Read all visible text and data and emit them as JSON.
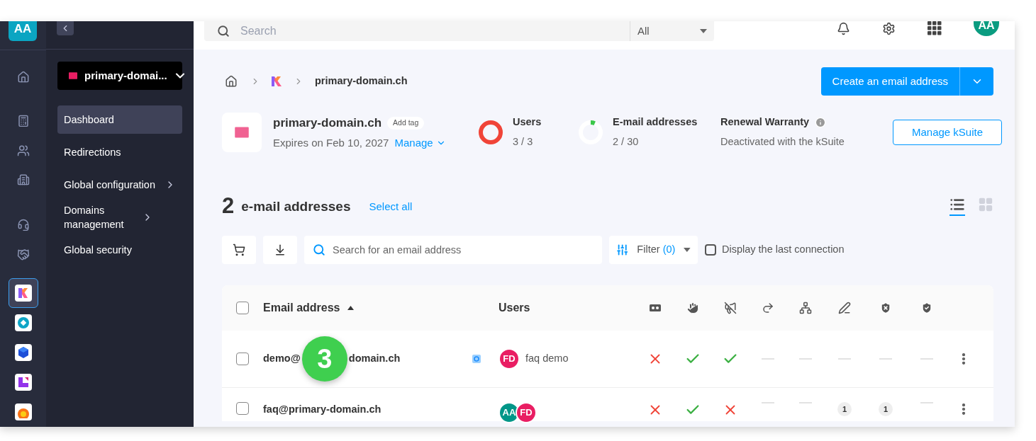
{
  "rail": {
    "avatar": "AA",
    "apps": [
      {
        "kind": "kdrive",
        "selected": true
      },
      {
        "kind": "ring",
        "selected": false
      },
      {
        "kind": "cube",
        "selected": false
      },
      {
        "kind": "corner",
        "selected": false
      },
      {
        "kind": "sun",
        "selected": false
      }
    ]
  },
  "sidebar": {
    "domain_select": "primary-domai...",
    "items": [
      {
        "label": "Dashboard",
        "selected": true,
        "expandable": false
      },
      {
        "label": "Redirections",
        "selected": false,
        "expandable": false
      },
      {
        "label": "Global configuration",
        "selected": false,
        "expandable": true
      },
      {
        "label": "Domains management",
        "selected": false,
        "expandable": true
      },
      {
        "label": "Global security",
        "selected": false,
        "expandable": false
      }
    ]
  },
  "topbar": {
    "search": {
      "placeholder": "Search"
    },
    "scope": "All",
    "avatar": "AA"
  },
  "breadcrumb": [
    "primary-domain.ch"
  ],
  "create_button": "Create an email address",
  "domain": {
    "name": "primary-domain.ch",
    "tag": "Add tag",
    "expires": "Expires on Feb 10, 2027",
    "manage": "Manage"
  },
  "stats": [
    {
      "label": "Users",
      "value": "3 / 3",
      "level": 1,
      "color": "#f04438"
    },
    {
      "label": "E-mail addresses",
      "value": "2 / 30",
      "level": 0.0667,
      "color": "#3cc84a"
    }
  ],
  "renewal": {
    "title": "Renewal Warranty",
    "status": "Deactivated with the kSuite"
  },
  "manage_ksuite": "Manage kSuite",
  "list": {
    "count": "2",
    "title": "e-mail addresses",
    "select_all": "Select all",
    "views": [
      {
        "kind": "list",
        "selected": true
      },
      {
        "kind": "grid",
        "selected": false
      }
    ]
  },
  "toolbar": {
    "search": {
      "placeholder": "Search for an email address"
    },
    "filter": "Filter",
    "filter_count": "(0)",
    "last_connection": {
      "label": "Display the last connection",
      "checked": false
    }
  },
  "table": {
    "all_checked": false,
    "columns": [
      {
        "label": "Email address",
        "sorted": true
      },
      {
        "label": "Users",
        "sorted": false
      }
    ],
    "rows": [
      {
        "checked": false,
        "address": "demo@",
        "annotation": "3",
        "address_after": "domain.ch",
        "synced": true,
        "users": [
          {
            "initials": "FD",
            "color": "#e91e63"
          }
        ],
        "user_name": "faq demo",
        "statuses": [
          {
            "kind": "cross"
          },
          {
            "kind": "check"
          },
          {
            "kind": "check"
          },
          {
            "kind": "dash"
          },
          {
            "kind": "dash"
          },
          {
            "kind": "dash"
          },
          {
            "kind": "dash"
          },
          {
            "kind": "dash"
          }
        ]
      },
      {
        "checked": false,
        "address": "faq@primary-domain.ch",
        "synced": false,
        "users": [
          {
            "initials": "AA",
            "color": "#009688"
          },
          {
            "initials": "FD",
            "color": "#e91e63"
          }
        ],
        "statuses": [
          {
            "kind": "cross"
          },
          {
            "kind": "check"
          },
          {
            "kind": "cross"
          },
          {
            "kind": "dash"
          },
          {
            "kind": "dash"
          },
          {
            "kind": "count",
            "text": "1"
          },
          {
            "kind": "count",
            "text": "1"
          },
          {
            "kind": "dash"
          }
        ]
      }
    ]
  }
}
